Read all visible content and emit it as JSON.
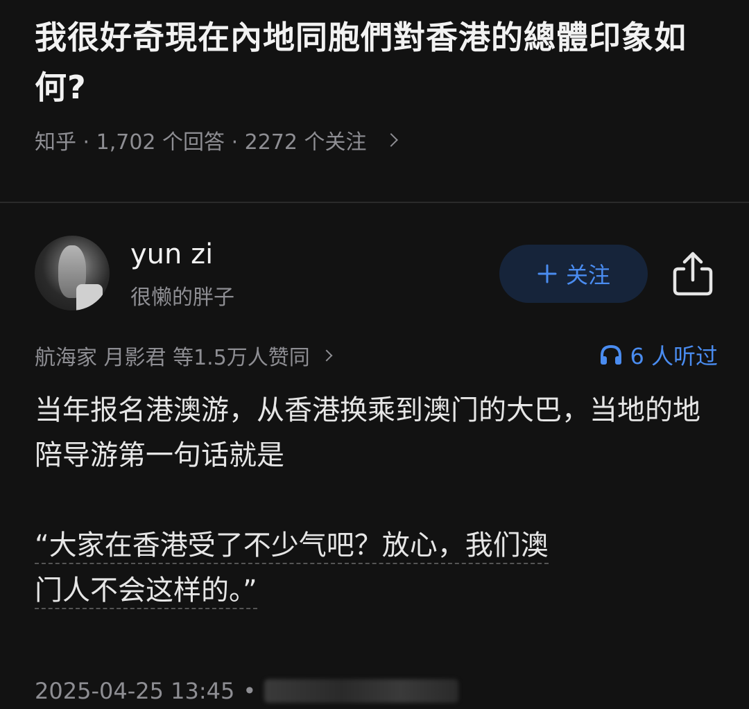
{
  "question": {
    "title": "我很好奇現在內地同胞們對香港的總體印象如何?",
    "meta": "知乎 · 1,702 个回答 · 2272 个关注"
  },
  "author": {
    "name": "yun zi",
    "subtitle": "很懒的胖子",
    "follow_label": "关注",
    "follow_icon": "plus-icon"
  },
  "endorse": {
    "text": "航海家 月影君 等1.5万人赞同"
  },
  "listened": {
    "icon": "headphones-icon",
    "text": "6 人听过"
  },
  "answer": {
    "paragraph1": "当年报名港澳游，从香港换乘到澳门的大巴，当地的地陪导游第一句话就是",
    "quote_line1": "“大家在香港受了不少气吧？放心，我们澳",
    "quote_line2": "门人不会这样的。”"
  },
  "footer": {
    "timestamp": "2025-04-25 13:45",
    "separator": "•"
  },
  "colors": {
    "background": "#121212",
    "accent": "#4a8cf0",
    "muted": "#8e8e93"
  }
}
